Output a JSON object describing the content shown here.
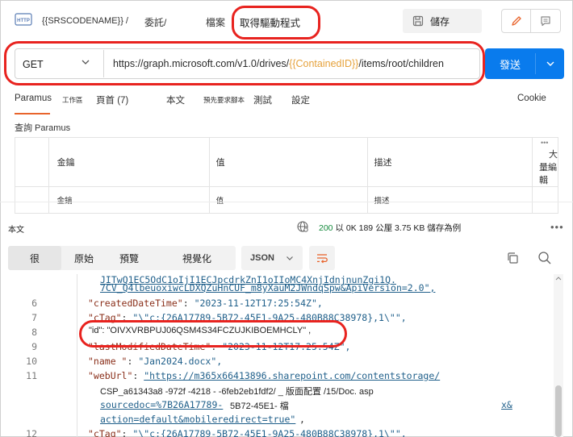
{
  "header": {
    "source_name": "{{SRSCODENAME}} /",
    "crumb_2": "委託/",
    "crumb_3": "檔案",
    "crumb_4": "取得驅動程式",
    "save_label": "儲存"
  },
  "request": {
    "method": "GET",
    "url_prefix": "https://graph.microsoft.com/v1.0/drives/",
    "url_variable": "{{ContainedID}}",
    "url_suffix": "/items/root/children",
    "send_label": "發送"
  },
  "tabs": {
    "params": "Paramus",
    "workspace": "工作區",
    "headers": "頁首 (7)",
    "body": "本文",
    "pre_request": "預先要求腳本",
    "tests": "測試",
    "settings": "設定",
    "cookies": "Cookie"
  },
  "params": {
    "section_title": "查詢 Paramus",
    "col_key": "金鑰",
    "col_value": "值",
    "col_description": "描述",
    "more": "•••",
    "bulk_edit": "大量編輯",
    "placeholder_key": "金鑰",
    "placeholder_value": "值",
    "placeholder_description": "描述"
  },
  "response": {
    "label": "本文",
    "status_code": "200",
    "status_rest": "以 0K 189 公厘 3.75 KB 儲存為例",
    "more": "•••"
  },
  "view": {
    "pretty": "很",
    "raw": "原始",
    "preview": "預覽",
    "visualize": "視覺化",
    "format": "JSON"
  },
  "code": {
    "top_line_1": "JITwQ1EC5OdC1oIjI1ECJpcdrkZnI1oIIoMC4XnjIdnjnunZgi1Q.",
    "top_line_2": "7CV_Q4lbeuoxiwcLDXQZuHnCUF_m8yXauM2JWndqSpw&ApiVersion=2.0\",",
    "line6_no": "6",
    "line6_key": "\"createdDateTime\"",
    "line6_val": "\"2023-11-12T17:25:54Z\",",
    "line7_no": "7",
    "line7_key": "\"cTag\"",
    "line7_val": "\"\\\"c:{26A17789-5B72-45E1-9A25-480B88C38978},1\\\"\",",
    "line8_no": "8",
    "line8_text": "\"id\": \"OIVXVRBPUJ06QSM4S34FCZUJKIBOEMHCLY\" ,",
    "line9_no": "9",
    "line9_key": "\"lastModifiedDateTime\"",
    "line9_val": "\"2023-11-12T17:25:54Z\",",
    "line10_no": "10",
    "line10_key": "\"name \"",
    "line10_val": "\"Jan2024.docx\",",
    "line11_no": "11",
    "line11_key": "\"webUrl\"",
    "line11_val": "\"https://m365x66413896.sharepoint.com/contentstorage/",
    "cont1": "CSP_a61343a8 -972f -4218 - -6feb2eb1fdf2/ _ 版面配置 /15/Doc. asp",
    "cont2_a": "sourcedoc=%7B26A17789-",
    "cont2_b": "5B72-45E1- 檔",
    "cont2_c": "x&",
    "cont3": "action=default&mobileredirect=true\"",
    "cont3_tail": ",",
    "line12_no": "12",
    "line12_key": "\"cTag\"",
    "line12_val": "\"\\\"c:{26A17789-5B72-45E1-9A25-480B88C38978},1\\\"\","
  },
  "colors": {
    "send": "#097bed",
    "accent": "#e8642c",
    "annotation": "#e8231f",
    "status_ok": "#148a3c"
  }
}
